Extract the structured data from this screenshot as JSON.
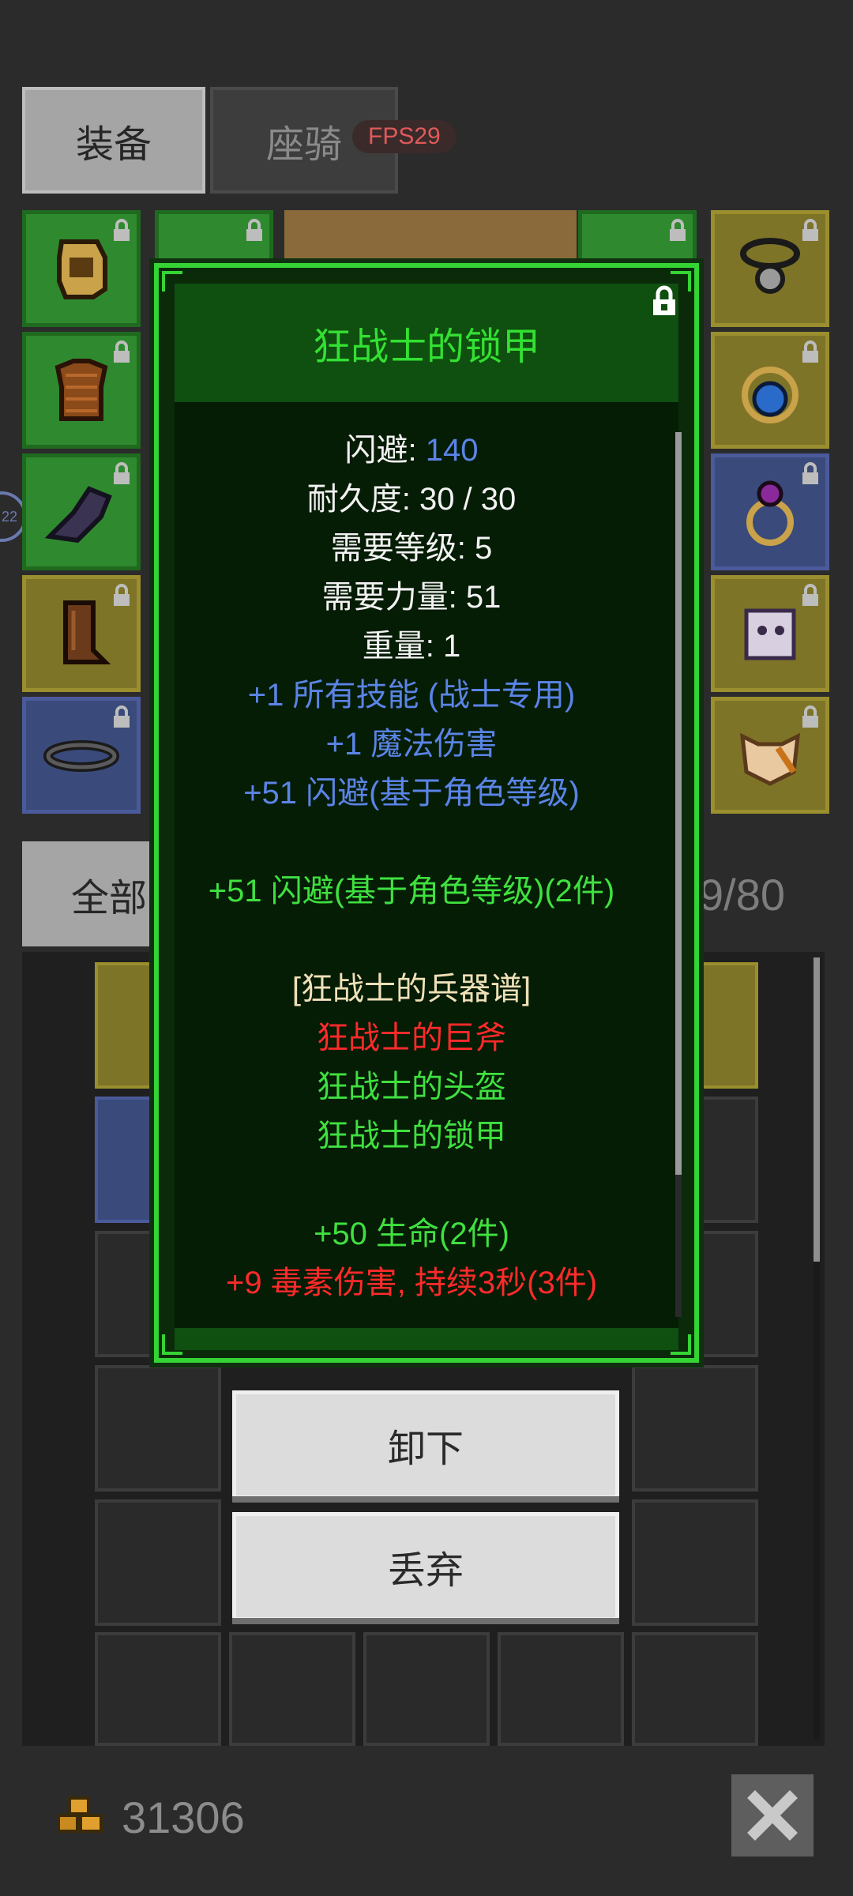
{
  "tabs": {
    "equip_label": "装备",
    "mount_label": "座骑",
    "fps_badge": "FPS29"
  },
  "left_bubble": "22",
  "filter": {
    "all_label": "全部",
    "count": "9/80"
  },
  "item_popup": {
    "title": "狂战士的锁甲",
    "stats": [
      {
        "label": "闪避: ",
        "value": "140"
      },
      {
        "text": "耐久度: 30 / 30"
      },
      {
        "text": "需要等级: 5"
      },
      {
        "text": "需要力量: 51"
      },
      {
        "text": "重量: 1"
      }
    ],
    "magic_props": [
      "+1 所有技能 (战士专用)",
      "+1 魔法伤害",
      "+51 闪避(基于角色等级)"
    ],
    "set_bonus_item": "+51 闪避(基于角色等级)(2件)",
    "set_name": "[狂战士的兵器谱]",
    "set_items": [
      {
        "name": "狂战士的巨斧",
        "owned": false
      },
      {
        "name": "狂战士的头盔",
        "owned": true
      },
      {
        "name": "狂战士的锁甲",
        "owned": true
      }
    ],
    "set_bonuses": [
      {
        "text": "+50 生命(2件)",
        "active": true
      },
      {
        "text": "+9 毒素伤害, 持续3秒(3件)",
        "active": false
      }
    ]
  },
  "actions": {
    "unequip_label": "卸下",
    "discard_label": "丢弃"
  },
  "footer": {
    "gold": "31306"
  },
  "colors": {
    "green_slot": "#2f8a2f",
    "yellow_slot": "#7e7428",
    "blue_slot": "#3a4a7a",
    "popup_border": "#35d435",
    "title_green": "#33e033"
  }
}
